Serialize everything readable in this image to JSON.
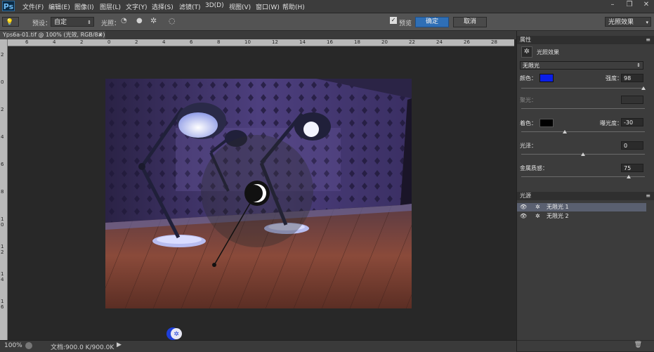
{
  "app": {
    "logo": "Ps"
  },
  "menu": [
    "文件(F)",
    "编辑(E)",
    "图像(I)",
    "图层(L)",
    "文字(Y)",
    "选择(S)",
    "滤镜(T)",
    "3D(D)",
    "视图(V)",
    "窗口(W)",
    "帮助(H)"
  ],
  "window_controls": [
    "–",
    "❐",
    "✕"
  ],
  "options": {
    "preset_label": "预设：",
    "preset_value": "自定",
    "lights_label": "光照：",
    "preview_label": "预览",
    "ok_label": "确定",
    "cancel_label": "取消",
    "workspace_value": "光照效果"
  },
  "document": {
    "tab_title": "Yps6a-01.tif @ 100% (光效, RGB/8#) *",
    "close_glyph": "×"
  },
  "ruler": {
    "h_ticks": [
      "6",
      "4",
      "2",
      "0",
      "2",
      "4",
      "6",
      "8",
      "10",
      "12",
      "14",
      "16",
      "18",
      "20",
      "22",
      "24",
      "26",
      "28"
    ],
    "v_ticks": [
      "2",
      "0",
      "2",
      "4",
      "6",
      "8",
      "1 0",
      "1 2",
      "1 4",
      "1 6"
    ]
  },
  "status": {
    "zoom": "100%",
    "doc_info": "文档:900.0 K/900.0K"
  },
  "properties": {
    "title": "属性",
    "subtitle": "光照效果",
    "light_type": "无限光",
    "color_label": "颜色：",
    "color_value": "#0a1ee8",
    "intensity_label": "强度：",
    "intensity_value": "98",
    "hotspot_label": "聚光：",
    "colorize_label": "着色：",
    "colorize_value": "#000000",
    "exposure_label": "曝光度：",
    "exposure_value": "-30",
    "gloss_label": "光泽：",
    "gloss_value": "0",
    "metallic_label": "金属质感：",
    "metallic_value": "75",
    "sliders": {
      "intensity": 0.99,
      "exposure": 0.35,
      "gloss": 0.5,
      "metallic": 0.87
    }
  },
  "lights_panel": {
    "title": "光源",
    "items": [
      {
        "label": "无限光 1",
        "selected": true
      },
      {
        "label": "无限光 2",
        "selected": false
      }
    ]
  }
}
